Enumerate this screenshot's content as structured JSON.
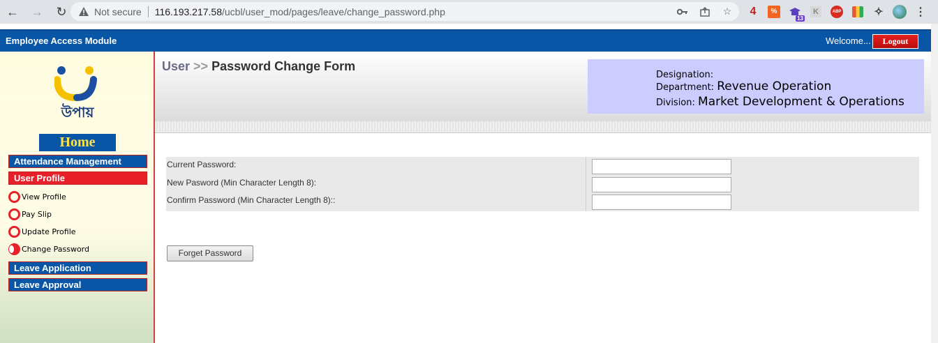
{
  "browser": {
    "security_label": "Not secure",
    "url_host": "116.193.217.58",
    "url_path": "/ucbl/user_mod/pages/leave/change_password.php",
    "ext_badge": "13",
    "ext_num": "4",
    "ext_abp": "ABP",
    "ext_k": "K"
  },
  "header": {
    "app_title": "Employee Access Module",
    "welcome": "Welcome...",
    "logout": "Logout"
  },
  "sidebar": {
    "logo_text": "উপায়",
    "home": "Home",
    "menus": {
      "attendance": "Attendance Management",
      "user_profile": "User Profile",
      "leave_application": "Leave Application",
      "leave_approval": "Leave Approval"
    },
    "sub_items": [
      {
        "label": "View Profile"
      },
      {
        "label": "Pay Slip"
      },
      {
        "label": "Update Profile"
      },
      {
        "label": "Change Password"
      }
    ]
  },
  "main": {
    "breadcrumb_root": "User",
    "breadcrumb_sep": ">>",
    "breadcrumb_page": "Password Change Form",
    "info": {
      "designation_label": "Designation:",
      "designation_value": "",
      "department_label": "Department:",
      "department_value": "Revenue Operation",
      "division_label": "Division:",
      "division_value": "Market Development & Operations"
    },
    "form": {
      "current_label": "Current Password:",
      "new_label": "New Pasword (Min Character Length 8):",
      "confirm_label": "Confirm Password (Min Character Length 8)::",
      "current_value": "",
      "new_value": "",
      "confirm_value": ""
    },
    "forget_button": "Forget Password"
  },
  "colors": {
    "app_blue": "#0a56a6",
    "accent_red": "#e8202a",
    "info_bg": "#ccccff",
    "home_text": "#ffe24a"
  }
}
